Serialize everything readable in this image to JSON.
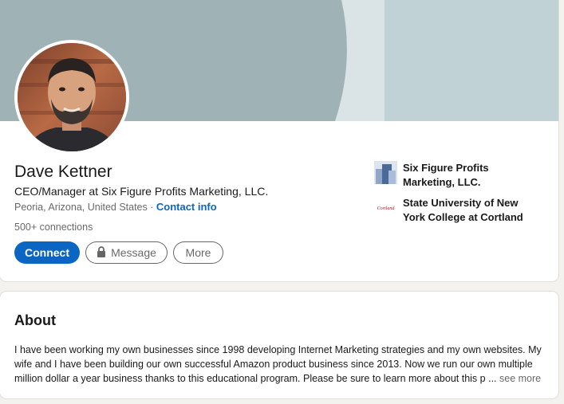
{
  "profile": {
    "name": "Dave Kettner",
    "headline": "CEO/Manager at Six Figure Profits Marketing, LLC.",
    "location": "Peoria, Arizona, United States",
    "separator": " · ",
    "contact_info": "Contact info",
    "connections": "500+ connections"
  },
  "actions": {
    "connect": "Connect",
    "message": "Message",
    "more": "More"
  },
  "affiliations": [
    {
      "label": "Six Figure Profits Marketing, LLC.",
      "icon": "company-logo-icon"
    },
    {
      "label": "State University of New York College at Cortland",
      "icon": "cortland-logo-icon",
      "logo_text": "Cortland"
    }
  ],
  "about": {
    "title": "About",
    "lines": [
      "I have been working my own businesses since 1998 developing Internet Marketing strategies and my own websites. My",
      "wife and I have been building our own successful Amazon product business since 2013. Now we run our own multiple",
      "million dollar a year business thanks to this educational program. Please be sure to learn more about this p"
    ],
    "ellipsis": "...",
    "see_more": "see more"
  },
  "colors": {
    "brand_blue": "#0a66c2",
    "banner_dark": "#9fb2b6",
    "banner_mid": "#dae3e5",
    "banner_light": "#c0d2d6",
    "page_bg": "#f3f2ef"
  }
}
